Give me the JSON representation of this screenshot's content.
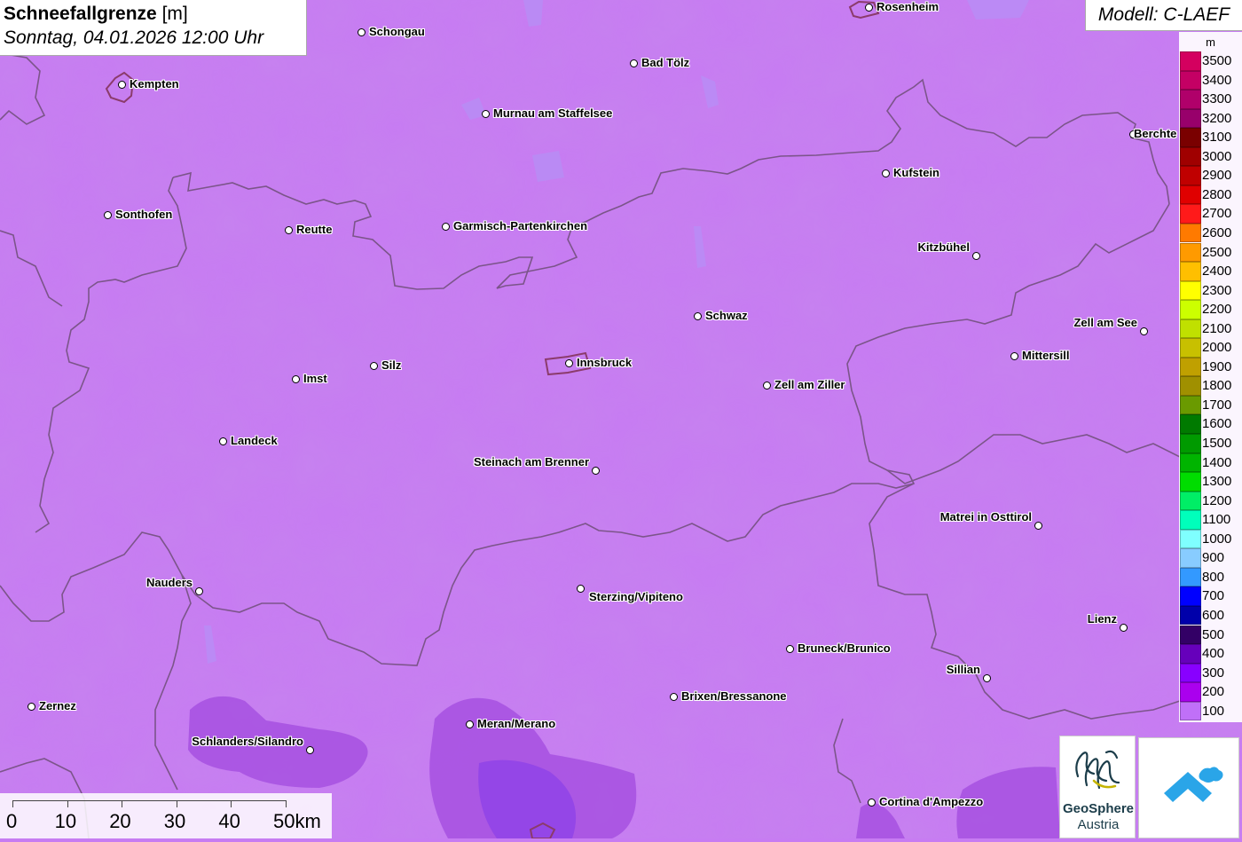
{
  "header": {
    "title": "Schneefallgrenze",
    "unit": "[m]",
    "datetime": "Sonntag, 04.01.2026 12:00 Uhr"
  },
  "model_label": "Modell: C-LAEF",
  "legend": {
    "unit": "m",
    "items": [
      {
        "label": "3500",
        "color": "#d4005f"
      },
      {
        "label": "3400",
        "color": "#c40064"
      },
      {
        "label": "3300",
        "color": "#b0006a"
      },
      {
        "label": "3200",
        "color": "#98006b"
      },
      {
        "label": "3100",
        "color": "#7a0000"
      },
      {
        "label": "3000",
        "color": "#a00000"
      },
      {
        "label": "2900",
        "color": "#c00000"
      },
      {
        "label": "2800",
        "color": "#e00000"
      },
      {
        "label": "2700",
        "color": "#ff1a1a"
      },
      {
        "label": "2600",
        "color": "#ff7a00"
      },
      {
        "label": "2500",
        "color": "#ff9a00"
      },
      {
        "label": "2400",
        "color": "#ffbf00"
      },
      {
        "label": "2300",
        "color": "#ffff00"
      },
      {
        "label": "2200",
        "color": "#ccff00"
      },
      {
        "label": "2100",
        "color": "#c0e000"
      },
      {
        "label": "2000",
        "color": "#c8c000"
      },
      {
        "label": "1900",
        "color": "#c0a000"
      },
      {
        "label": "1800",
        "color": "#a09000"
      },
      {
        "label": "1700",
        "color": "#6a9a00"
      },
      {
        "label": "1600",
        "color": "#007a00"
      },
      {
        "label": "1500",
        "color": "#009a00"
      },
      {
        "label": "1400",
        "color": "#00b400"
      },
      {
        "label": "1300",
        "color": "#00dd00"
      },
      {
        "label": "1200",
        "color": "#00ee66"
      },
      {
        "label": "1100",
        "color": "#00ffbb"
      },
      {
        "label": "1000",
        "color": "#7fffff"
      },
      {
        "label": "900",
        "color": "#88ccff"
      },
      {
        "label": "800",
        "color": "#3399ff"
      },
      {
        "label": "700",
        "color": "#0000ff"
      },
      {
        "label": "600",
        "color": "#0000aa"
      },
      {
        "label": "500",
        "color": "#330066"
      },
      {
        "label": "400",
        "color": "#6600bb"
      },
      {
        "label": "300",
        "color": "#8800ff"
      },
      {
        "label": "200",
        "color": "#aa00ee"
      },
      {
        "label": "100",
        "color": "#c070f8"
      }
    ]
  },
  "cities": [
    {
      "name": "Rosenheim"
    },
    {
      "name": "Schongau"
    },
    {
      "name": "Kempten"
    },
    {
      "name": "Bad Tölz"
    },
    {
      "name": "Murnau am Staffelsee"
    },
    {
      "name": "Berchte"
    },
    {
      "name": "Kufstein"
    },
    {
      "name": "Sonthofen"
    },
    {
      "name": "Reutte"
    },
    {
      "name": "Garmisch-Partenkirchen"
    },
    {
      "name": "Kitzbühel"
    },
    {
      "name": "Schwaz"
    },
    {
      "name": "Zell am See"
    },
    {
      "name": "Mittersill"
    },
    {
      "name": "Silz"
    },
    {
      "name": "Innsbruck"
    },
    {
      "name": "Imst"
    },
    {
      "name": "Zell am Ziller"
    },
    {
      "name": "Landeck"
    },
    {
      "name": "Steinach am Brenner"
    },
    {
      "name": "Matrei in Osttirol"
    },
    {
      "name": "Nauders"
    },
    {
      "name": "Sterzing/Vipiteno"
    },
    {
      "name": "Lienz"
    },
    {
      "name": "Bruneck/Brunico"
    },
    {
      "name": "Sillian"
    },
    {
      "name": "Brixen/Bressanone"
    },
    {
      "name": "Zernez"
    },
    {
      "name": "Meran/Merano"
    },
    {
      "name": "Schlanders/Silandro"
    },
    {
      "name": "Cortina d'Ampezzo"
    }
  ],
  "scale": {
    "labels": [
      "0",
      "10",
      "20",
      "30",
      "40",
      "50km"
    ]
  },
  "logos": {
    "geosphere_line1": "GeoSphere",
    "geosphere_line2": "Austria"
  }
}
